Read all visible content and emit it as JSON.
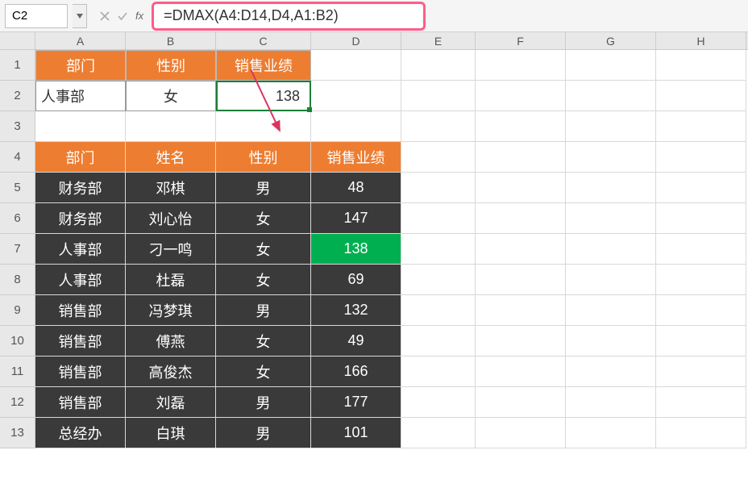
{
  "namebox": {
    "value": "C2"
  },
  "formula_bar": {
    "text": "=DMAX(A4:D14,D4,A1:B2)"
  },
  "columns": [
    "A",
    "B",
    "C",
    "D",
    "E",
    "F",
    "G",
    "H"
  ],
  "rows": [
    "1",
    "2",
    "3",
    "4",
    "5",
    "6",
    "7",
    "8",
    "9",
    "10",
    "11",
    "12",
    "13"
  ],
  "criteria_headers": {
    "A1": "部门",
    "B1": "性别",
    "C1": "销售业绩"
  },
  "criteria_values": {
    "A2": "人事部",
    "B2": "女",
    "C2": "138"
  },
  "table_headers": {
    "A4": "部门",
    "B4": "姓名",
    "C4": "性别",
    "D4": "销售业绩"
  },
  "table_rows": [
    {
      "dept": "财务部",
      "name": "邓棋",
      "gender": "男",
      "sales": "48"
    },
    {
      "dept": "财务部",
      "name": "刘心怡",
      "gender": "女",
      "sales": "147"
    },
    {
      "dept": "人事部",
      "name": "刁一鸣",
      "gender": "女",
      "sales": "138",
      "highlight": true
    },
    {
      "dept": "人事部",
      "name": "杜磊",
      "gender": "女",
      "sales": "69"
    },
    {
      "dept": "销售部",
      "name": "冯梦琪",
      "gender": "男",
      "sales": "132"
    },
    {
      "dept": "销售部",
      "name": "傅燕",
      "gender": "女",
      "sales": "49"
    },
    {
      "dept": "销售部",
      "name": "高俊杰",
      "gender": "女",
      "sales": "166"
    },
    {
      "dept": "销售部",
      "name": "刘磊",
      "gender": "男",
      "sales": "177"
    },
    {
      "dept": "总经办",
      "name": "白琪",
      "gender": "男",
      "sales": "101"
    }
  ],
  "colors": {
    "orange": "#ed7d31",
    "dark": "#3a3a3a",
    "green": "#00b050",
    "pink_border": "#ff5c8a",
    "selection_green": "#1a7f37"
  }
}
